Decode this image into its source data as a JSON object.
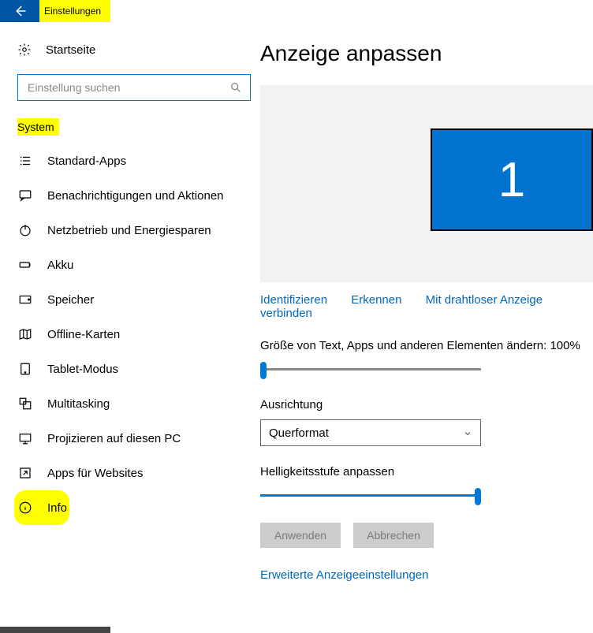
{
  "window": {
    "title": "Einstellungen"
  },
  "sidebar": {
    "home": "Startseite",
    "search_placeholder": "Einstellung suchen",
    "section": "System",
    "items": [
      {
        "label": "Standard-Apps"
      },
      {
        "label": "Benachrichtigungen und Aktionen"
      },
      {
        "label": "Netzbetrieb und Energiesparen"
      },
      {
        "label": "Akku"
      },
      {
        "label": "Speicher"
      },
      {
        "label": "Offline-Karten"
      },
      {
        "label": "Tablet-Modus"
      },
      {
        "label": "Multitasking"
      },
      {
        "label": "Projizieren auf diesen PC"
      },
      {
        "label": "Apps für Websites"
      },
      {
        "label": "Info"
      }
    ]
  },
  "main": {
    "heading": "Anzeige anpassen",
    "monitor_number": "1",
    "links": {
      "identify": "Identifizieren",
      "detect": "Erkennen",
      "wireless": "Mit drahtloser Anzeige verbinden"
    },
    "scale_label": "Größe von Text, Apps und anderen Elementen ändern: 100%",
    "orientation_label": "Ausrichtung",
    "orientation_value": "Querformat",
    "brightness_label": "Helligkeitsstufe anpassen",
    "apply": "Anwenden",
    "cancel": "Abbrechen",
    "advanced": "Erweiterte Anzeigeeinstellungen"
  }
}
